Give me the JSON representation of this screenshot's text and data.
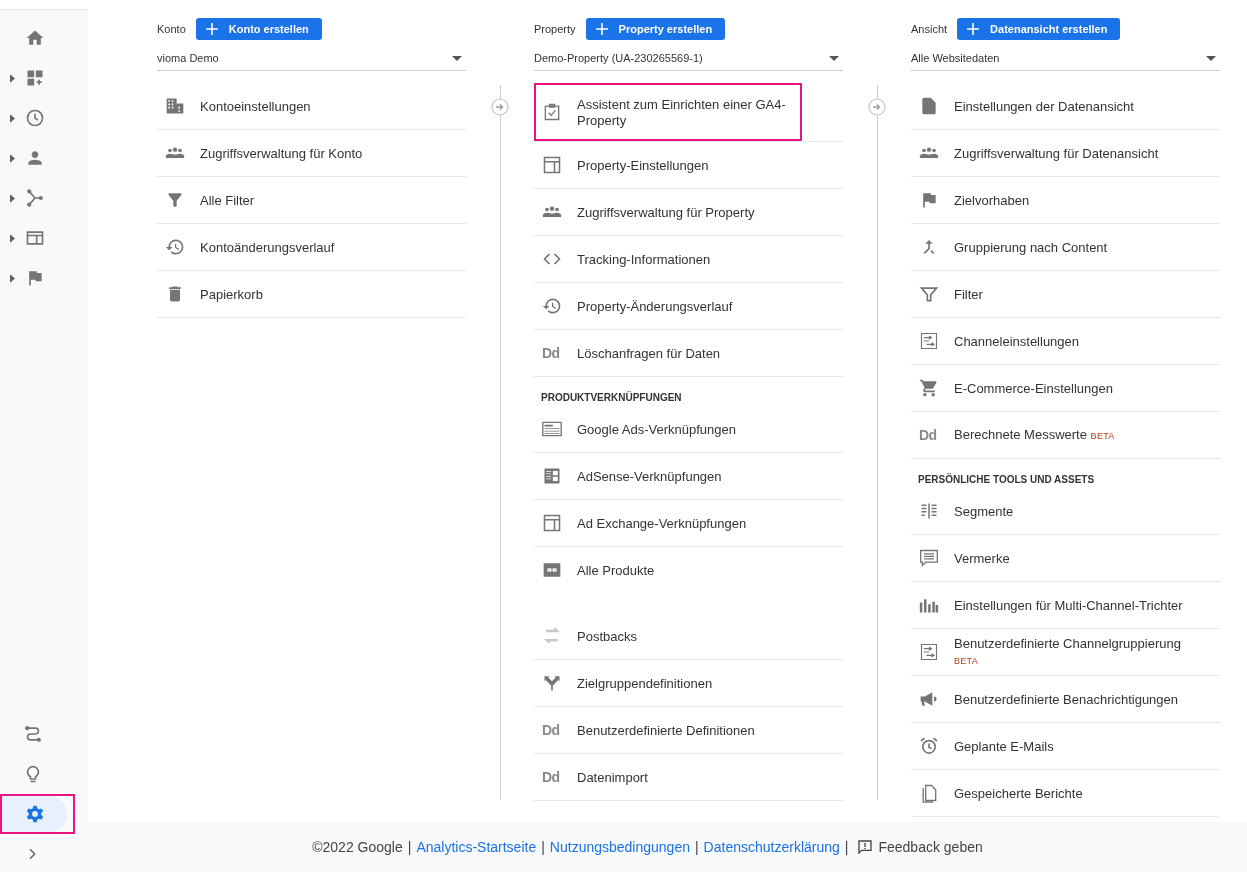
{
  "sidebar": {
    "nav": [
      {
        "expandable": false
      },
      {
        "expandable": true
      },
      {
        "expandable": true
      },
      {
        "expandable": true
      },
      {
        "expandable": true
      },
      {
        "expandable": true
      },
      {
        "expandable": true
      }
    ],
    "bottom": [
      {
        "selected": false,
        "highlighted": false
      },
      {
        "selected": false,
        "highlighted": false
      },
      {
        "selected": true,
        "highlighted": true
      }
    ]
  },
  "columns": [
    {
      "label": "Konto",
      "create_button": "Konto erstellen",
      "selector": "vioma Demo",
      "rows": [
        {
          "kind": "item",
          "text": "Kontoeinstellungen",
          "highlighted": false
        },
        {
          "kind": "item",
          "text": "Zugriffsverwaltung für Konto",
          "highlighted": false
        },
        {
          "kind": "item",
          "text": "Alle Filter",
          "highlighted": false
        },
        {
          "kind": "item",
          "text": "Kontoänderungsverlauf",
          "highlighted": false
        },
        {
          "kind": "item",
          "text": "Papierkorb",
          "highlighted": false
        }
      ]
    },
    {
      "label": "Property",
      "create_button": "Property erstellen",
      "selector": "Demo-Property (UA-230265569-1)",
      "rows": [
        {
          "kind": "item",
          "text": "Assistent zum Einrichten einer GA4-Property",
          "highlighted": true
        },
        {
          "kind": "item",
          "text": "Property-Einstellungen",
          "highlighted": false
        },
        {
          "kind": "item",
          "text": "Zugriffsverwaltung für Property",
          "highlighted": false
        },
        {
          "kind": "item",
          "text": "Tracking-Informationen",
          "highlighted": false
        },
        {
          "kind": "item",
          "text": "Property-Änderungsverlauf",
          "highlighted": false
        },
        {
          "kind": "item",
          "text": "Löschanfragen für Daten",
          "icon_text": "Dd",
          "highlighted": false
        },
        {
          "kind": "section",
          "text": "PRODUKTVERKNÜPFUNGEN"
        },
        {
          "kind": "item",
          "text": "Google Ads-Verknüpfungen",
          "highlighted": false
        },
        {
          "kind": "item",
          "text": "AdSense-Verknüpfungen",
          "highlighted": false
        },
        {
          "kind": "item",
          "text": "Ad Exchange-Verknüpfungen",
          "highlighted": false
        },
        {
          "kind": "item",
          "text": "Alle Produkte",
          "highlighted": false,
          "gap_after": true
        },
        {
          "kind": "item",
          "text": "Postbacks",
          "highlighted": false
        },
        {
          "kind": "item",
          "text": "Zielgruppendefinitionen",
          "highlighted": false
        },
        {
          "kind": "item",
          "text": "Benutzerdefinierte Definitionen",
          "icon_text": "Dd",
          "highlighted": false
        },
        {
          "kind": "item",
          "text": "Datenimport",
          "icon_text": "Dd",
          "highlighted": false
        }
      ]
    },
    {
      "label": "Ansicht",
      "create_button": "Datenansicht erstellen",
      "selector": "Alle Websitedaten",
      "rows": [
        {
          "kind": "item",
          "text": "Einstellungen der Datenansicht",
          "highlighted": false
        },
        {
          "kind": "item",
          "text": "Zugriffsverwaltung für Datenansicht",
          "highlighted": false
        },
        {
          "kind": "item",
          "text": "Zielvorhaben",
          "highlighted": false
        },
        {
          "kind": "item",
          "text": "Gruppierung nach Content",
          "highlighted": false
        },
        {
          "kind": "item",
          "text": "Filter",
          "highlighted": false
        },
        {
          "kind": "item",
          "text": "Channeleinstellungen",
          "highlighted": false
        },
        {
          "kind": "item",
          "text": "E-Commerce-Einstellungen",
          "highlighted": false
        },
        {
          "kind": "item",
          "text": "Berechnete Messwerte",
          "icon_text": "Dd",
          "badge": "BETA",
          "highlighted": false
        },
        {
          "kind": "section",
          "text": "PERSÖNLICHE TOOLS UND ASSETS"
        },
        {
          "kind": "item",
          "text": "Segmente",
          "highlighted": false
        },
        {
          "kind": "item",
          "text": "Vermerke",
          "highlighted": false
        },
        {
          "kind": "item",
          "text": "Einstellungen für Multi-Channel-Trichter",
          "highlighted": false
        },
        {
          "kind": "item",
          "text": "Benutzerdefinierte Channelgruppierung",
          "badge": "BETA",
          "highlighted": false
        },
        {
          "kind": "item",
          "text": "Benutzerdefinierte Benachrichtigungen",
          "highlighted": false
        },
        {
          "kind": "item",
          "text": "Geplante E-Mails",
          "highlighted": false
        },
        {
          "kind": "item",
          "text": "Gespeicherte Berichte",
          "highlighted": false
        }
      ]
    }
  ],
  "footer": {
    "copyright": "©2022 Google",
    "separator": "|",
    "links": [
      "Analytics-Startseite",
      "Nutzungsbedingungen",
      "Datenschutzerklärung"
    ],
    "feedback": "Feedback geben"
  }
}
